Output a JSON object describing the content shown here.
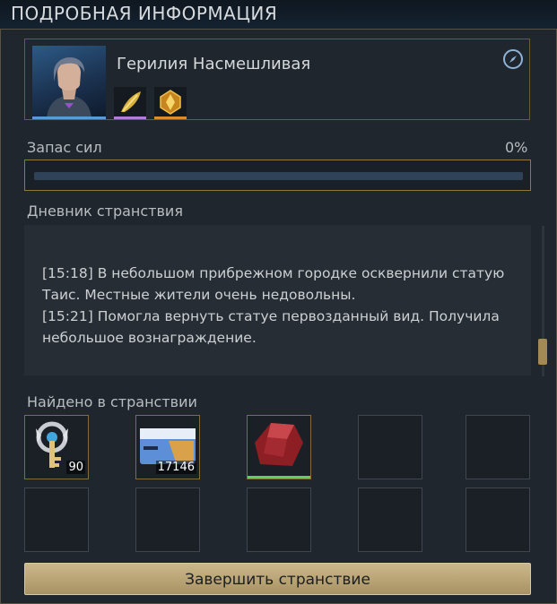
{
  "header": {
    "title": "ПОДРОБНАЯ ИНФОРМАЦИЯ"
  },
  "character": {
    "name": "Герилия Насмешливая",
    "portrait_icon": "character-portrait",
    "skills": [
      {
        "icon": "golden-feather-skill-icon",
        "rarity_color": "#b37bdc"
      },
      {
        "icon": "amber-crystal-skill-icon",
        "rarity_color": "#e08a2e"
      }
    ]
  },
  "stamina": {
    "label": "Запас сил",
    "percent_text": "0%",
    "value": 0
  },
  "journal": {
    "label": "Дневник странствия",
    "entries": [
      "[15:18] В небольшом прибрежном городке осквернили статую Таис. Местные жители очень недовольны.",
      "[15:21] Помогла вернуть статуе первозданный вид. Получила небольшое вознаграждение."
    ]
  },
  "found": {
    "label": "Найдено в странствии",
    "items": [
      {
        "icon": "key-emblem-icon",
        "count": "90"
      },
      {
        "icon": "ticket-card-icon",
        "count": "17146"
      },
      {
        "icon": "red-ore-icon",
        "count": ""
      }
    ]
  },
  "finish_button": {
    "label": "Завершить странствие"
  },
  "colors": {
    "gold_border": "#8c7a3e",
    "button": "#b9a577",
    "rarity_green": "#5fd05a"
  }
}
